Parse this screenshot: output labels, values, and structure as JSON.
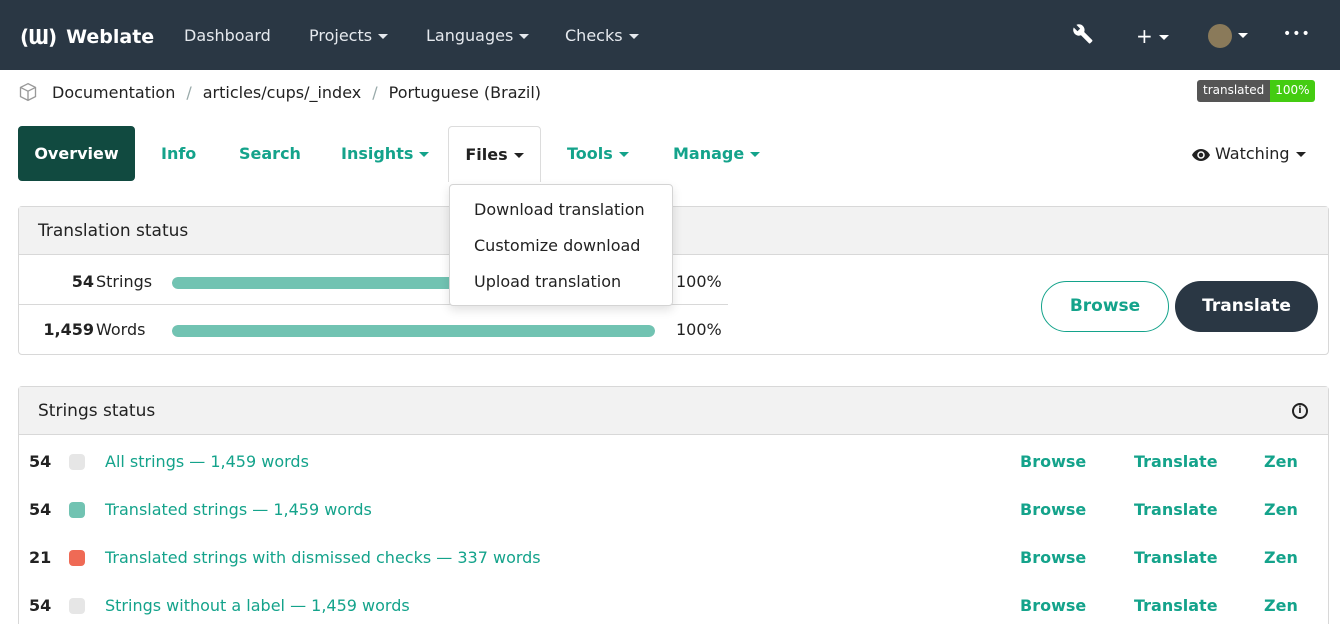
{
  "navbar": {
    "logo": "(Ɯ)",
    "brand": "Weblate",
    "items": [
      "Dashboard",
      "Projects",
      "Languages",
      "Checks"
    ],
    "wrench_icon": "wrench-icon",
    "plus_label": "+",
    "more_label": "•••"
  },
  "breadcrumb": {
    "items": [
      "Documentation",
      "articles/cups/_index",
      "Portuguese (Brazil)"
    ],
    "separator": "/"
  },
  "badge": {
    "label": "translated",
    "value": "100%"
  },
  "tabs": [
    "Overview",
    "Info",
    "Search",
    "Insights",
    "Files",
    "Tools",
    "Manage"
  ],
  "watching": "Watching",
  "files_menu": [
    "Download translation",
    "Customize download",
    "Upload translation"
  ],
  "translation_status": {
    "title": "Translation status",
    "rows": [
      {
        "count": "54",
        "label": "Strings",
        "percent": "100%",
        "fill": 1.0
      },
      {
        "count": "1,459",
        "label": "Words",
        "percent": "100%",
        "fill": 1.0
      }
    ],
    "browse": "Browse",
    "translate": "Translate"
  },
  "strings_status": {
    "title": "Strings status",
    "rows": [
      {
        "count": "54",
        "label": "All strings — 1,459 words",
        "color": "#e6e6e6"
      },
      {
        "count": "54",
        "label": "Translated strings — 1,459 words",
        "color": "#71c3b2"
      },
      {
        "count": "21",
        "label": "Translated strings with dismissed checks — 337 words",
        "color": "#ef6a55"
      },
      {
        "count": "54",
        "label": "Strings without a label — 1,459 words",
        "color": "#e6e6e6"
      }
    ],
    "actions": [
      "Browse",
      "Translate",
      "Zen"
    ]
  }
}
